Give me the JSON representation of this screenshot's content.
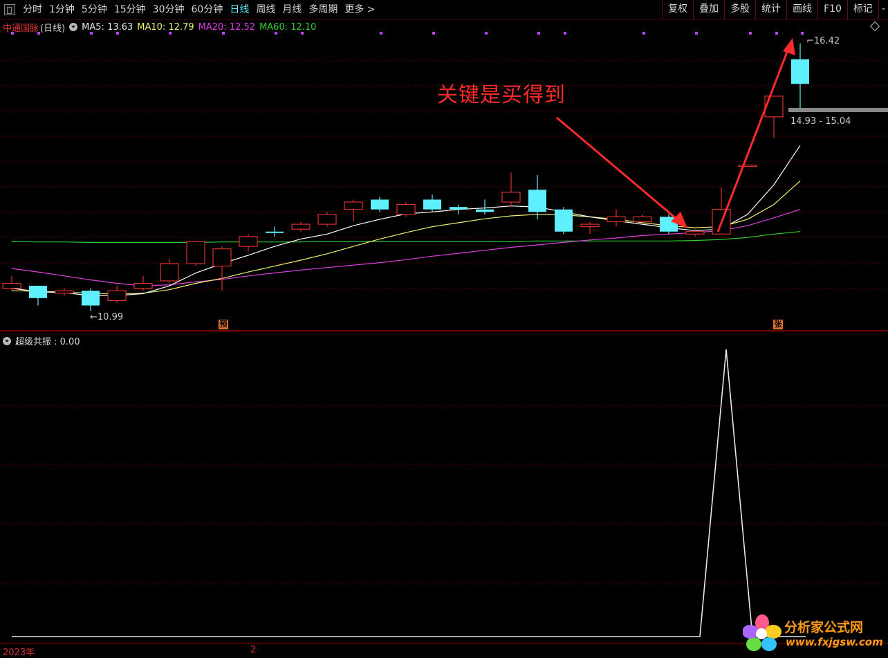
{
  "toolbar": {
    "periods": [
      "分时",
      "1分钟",
      "5分钟",
      "15分钟",
      "30分钟",
      "60分钟",
      "日线",
      "周线",
      "月线",
      "多周期",
      "更多 >"
    ],
    "active_period": "日线",
    "right_buttons": [
      "复权",
      "叠加",
      "多股",
      "统计",
      "画线",
      "F10",
      "标记",
      "-"
    ]
  },
  "legend": {
    "stock_name": "中通国脉",
    "period_label": "(日线)",
    "ma5": "MA5: 13.63",
    "ma10": "MA10: 12.79",
    "ma20": "MA20: 12.52",
    "ma60": "MA60: 12.10"
  },
  "colors": {
    "up": "#e03030",
    "down": "#5ef0ff",
    "ma5": "#ffffff",
    "ma10": "#f0f070",
    "ma20": "#e040e0",
    "ma60": "#30d030",
    "annotation": "#ff2a2a"
  },
  "annotations": {
    "text": "关键是买得到",
    "high_label": "16.42",
    "low_label": "10.99",
    "range_label": "14.93 - 15.04",
    "marker_yu": "预",
    "marker_zhang": "张"
  },
  "indicator": {
    "name": "超级共振",
    "value_label": "超级共振 : 0.00"
  },
  "x_axis": {
    "year_label": "2023年",
    "month_label": "2"
  },
  "watermark": {
    "name": "分析家公式网",
    "url": "www.fxjgsw.com"
  },
  "chart_data": {
    "type": "candlestick",
    "title": "中通国脉 (日线)",
    "candles": [
      {
        "open": 11.55,
        "close": 11.45,
        "high": 11.7,
        "low": 11.4,
        "dir": "up"
      },
      {
        "open": 11.5,
        "close": 11.25,
        "high": 11.5,
        "low": 11.1,
        "dir": "down"
      },
      {
        "open": 11.35,
        "close": 11.4,
        "high": 11.45,
        "low": 11.3,
        "dir": "up"
      },
      {
        "open": 11.4,
        "close": 11.1,
        "high": 11.45,
        "low": 10.99,
        "dir": "down"
      },
      {
        "open": 11.2,
        "close": 11.4,
        "high": 11.5,
        "low": 11.15,
        "dir": "up"
      },
      {
        "open": 11.45,
        "close": 11.55,
        "high": 11.7,
        "low": 11.4,
        "dir": "up"
      },
      {
        "open": 11.6,
        "close": 11.95,
        "high": 12.05,
        "low": 11.55,
        "dir": "up"
      },
      {
        "open": 11.95,
        "close": 12.4,
        "high": 12.4,
        "low": 11.9,
        "dir": "up"
      },
      {
        "open": 11.9,
        "close": 12.25,
        "high": 12.3,
        "low": 11.4,
        "dir": "up"
      },
      {
        "open": 12.3,
        "close": 12.5,
        "high": 12.55,
        "low": 12.2,
        "dir": "up"
      },
      {
        "open": 12.6,
        "close": 12.6,
        "high": 12.7,
        "low": 12.5,
        "dir": "down"
      },
      {
        "open": 12.65,
        "close": 12.75,
        "high": 12.8,
        "low": 12.6,
        "dir": "up"
      },
      {
        "open": 12.75,
        "close": 12.95,
        "high": 13.0,
        "low": 12.7,
        "dir": "up"
      },
      {
        "open": 13.05,
        "close": 13.2,
        "high": 13.25,
        "low": 12.8,
        "dir": "up"
      },
      {
        "open": 13.25,
        "close": 13.05,
        "high": 13.3,
        "low": 13.0,
        "dir": "down"
      },
      {
        "open": 12.95,
        "close": 13.15,
        "high": 13.2,
        "low": 12.9,
        "dir": "up"
      },
      {
        "open": 13.25,
        "close": 13.05,
        "high": 13.35,
        "low": 13.0,
        "dir": "down"
      },
      {
        "open": 13.1,
        "close": 13.05,
        "high": 13.15,
        "low": 12.95,
        "dir": "down"
      },
      {
        "open": 13.05,
        "close": 13.0,
        "high": 13.25,
        "low": 12.95,
        "dir": "down"
      },
      {
        "open": 13.2,
        "close": 13.4,
        "high": 13.8,
        "low": 13.1,
        "dir": "up"
      },
      {
        "open": 13.45,
        "close": 13.0,
        "high": 13.75,
        "low": 12.85,
        "dir": "down"
      },
      {
        "open": 13.05,
        "close": 12.6,
        "high": 13.1,
        "low": 12.55,
        "dir": "down"
      },
      {
        "open": 12.75,
        "close": 12.7,
        "high": 12.8,
        "low": 12.55,
        "dir": "up"
      },
      {
        "open": 12.8,
        "close": 12.9,
        "high": 13.05,
        "low": 12.7,
        "dir": "up"
      },
      {
        "open": 12.9,
        "close": 12.8,
        "high": 12.95,
        "low": 12.75,
        "dir": "up"
      },
      {
        "open": 12.9,
        "close": 12.6,
        "high": 12.95,
        "low": 12.55,
        "dir": "down"
      },
      {
        "open": 12.55,
        "close": 12.6,
        "high": 12.65,
        "low": 12.5,
        "dir": "up"
      },
      {
        "open": 12.55,
        "close": 13.05,
        "high": 13.5,
        "low": 12.55,
        "dir": "up"
      },
      {
        "open": 13.95,
        "close": 13.95,
        "high": 13.95,
        "low": 13.95,
        "dir": "up"
      },
      {
        "open": 14.93,
        "close": 15.35,
        "high": 15.35,
        "low": 14.5,
        "dir": "up"
      },
      {
        "open": 16.1,
        "close": 15.6,
        "high": 16.42,
        "low": 15.1,
        "dir": "down"
      }
    ],
    "ma5": [
      11.45,
      11.38,
      11.36,
      11.3,
      11.3,
      11.34,
      11.5,
      11.76,
      11.95,
      12.12,
      12.3,
      12.45,
      12.55,
      12.72,
      12.85,
      12.96,
      13.0,
      13.05,
      13.08,
      13.12,
      13.1,
      13.0,
      12.9,
      12.82,
      12.75,
      12.68,
      12.62,
      12.65,
      12.95,
      13.55,
      14.35
    ],
    "ma10": [
      11.4,
      11.39,
      11.37,
      11.35,
      11.33,
      11.35,
      11.42,
      11.55,
      11.65,
      11.78,
      11.9,
      12.02,
      12.15,
      12.3,
      12.45,
      12.58,
      12.7,
      12.78,
      12.86,
      12.92,
      12.95,
      12.94,
      12.9,
      12.85,
      12.78,
      12.72,
      12.68,
      12.7,
      12.85,
      13.15,
      13.63
    ],
    "ma20": [
      11.85,
      11.78,
      11.7,
      11.62,
      11.55,
      11.5,
      11.52,
      11.58,
      11.63,
      11.7,
      11.76,
      11.82,
      11.87,
      11.92,
      11.97,
      12.03,
      12.1,
      12.16,
      12.22,
      12.28,
      12.33,
      12.38,
      12.43,
      12.47,
      12.52,
      12.55,
      12.58,
      12.62,
      12.72,
      12.88,
      13.05
    ],
    "ma60": [
      12.4,
      12.39,
      12.39,
      12.38,
      12.38,
      12.38,
      12.38,
      12.38,
      12.39,
      12.39,
      12.39,
      12.39,
      12.4,
      12.4,
      12.4,
      12.4,
      12.4,
      12.4,
      12.4,
      12.4,
      12.41,
      12.41,
      12.41,
      12.41,
      12.41,
      12.41,
      12.42,
      12.44,
      12.48,
      12.55,
      12.6
    ],
    "indicator_values": [
      0,
      0,
      0,
      0,
      0,
      0,
      0,
      0,
      0,
      0,
      0,
      0,
      0,
      0,
      0,
      0,
      0,
      0,
      0,
      0,
      0,
      0,
      0,
      0,
      0,
      0,
      0,
      1,
      0,
      0,
      0
    ],
    "indicator_series_name": "超级共振",
    "ylim": [
      10.7,
      16.6
    ]
  }
}
